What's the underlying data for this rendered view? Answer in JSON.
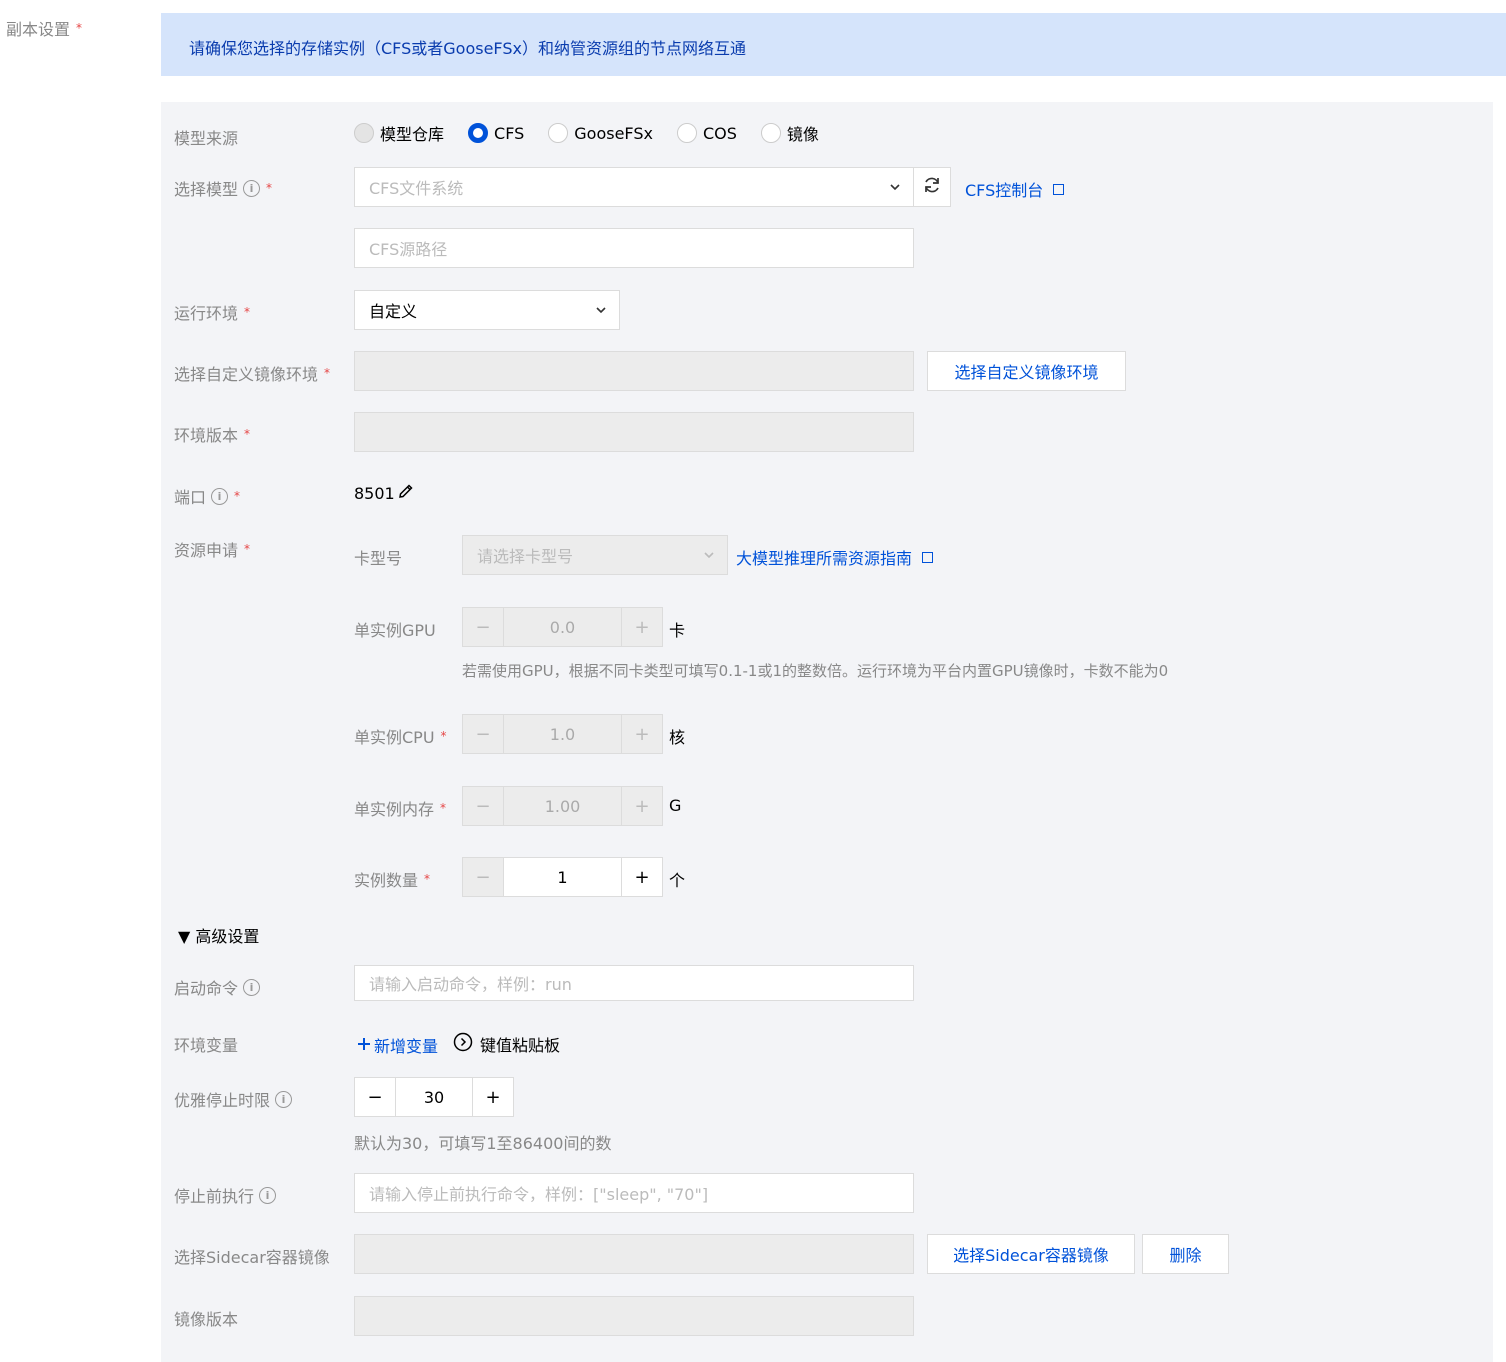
{
  "section": {
    "label": "副本设置",
    "required": "*"
  },
  "notice": {
    "text": "请确保您选择的存储实例（CFS或者GooseFSx）和纳管资源组的节点网络互通"
  },
  "model_source": {
    "label": "模型来源",
    "options": [
      "模型仓库",
      "CFS",
      "GooseFSx",
      "COS",
      "镜像"
    ],
    "selected": "CFS"
  },
  "select_model": {
    "label": "选择模型",
    "required": "*",
    "fs_placeholder": "CFS文件系统",
    "console_link": "CFS控制台",
    "path_placeholder": "CFS源路径"
  },
  "runtime": {
    "label": "运行环境",
    "required": "*",
    "value": "自定义"
  },
  "custom_image": {
    "label": "选择自定义镜像环境",
    "required": "*",
    "button": "选择自定义镜像环境"
  },
  "env_version": {
    "label": "环境版本",
    "required": "*"
  },
  "port": {
    "label": "端口",
    "required": "*",
    "value": "8501"
  },
  "resource": {
    "label": "资源申请",
    "required": "*",
    "card_label": "卡型号",
    "card_placeholder": "请选择卡型号",
    "guide_link": "大模型推理所需资源指南",
    "gpu_label": "单实例GPU",
    "gpu_value": "0.0",
    "gpu_unit": "卡",
    "gpu_hint": "若需使用GPU，根据不同卡类型可填写0.1-1或1的整数倍。运行环境为平台内置GPU镜像时，卡数不能为0",
    "cpu_label": "单实例CPU",
    "cpu_value": "1.0",
    "cpu_unit": "核",
    "mem_label": "单实例内存",
    "mem_value": "1.00",
    "mem_unit": "G",
    "count_label": "实例数量",
    "count_value": "1",
    "count_unit": "个"
  },
  "advanced": {
    "toggle": "▼ 高级设置",
    "start_cmd_label": "启动命令",
    "start_cmd_placeholder": "请输入启动命令，样例：run",
    "env_var_label": "环境变量",
    "add_var": "新增变量",
    "kv_paste": "键值粘贴板",
    "grace_label": "优雅停止时限",
    "grace_value": "30",
    "grace_hint": "默认为30，可填写1至86400间的数",
    "prestop_label": "停止前执行",
    "prestop_placeholder": "请输入停止前执行命令，样例：[\"sleep\", \"70\"]",
    "sidecar_label": "选择Sidecar容器镜像",
    "sidecar_button": "选择Sidecar容器镜像",
    "delete_button": "删除",
    "image_version_label": "镜像版本"
  },
  "common": {
    "minus": "−",
    "plus": "+"
  },
  "colors": {
    "primary": "#0052d9",
    "notice_bg": "#d5e4fb",
    "panel_bg": "#f3f4f7",
    "required": "#e54545"
  }
}
